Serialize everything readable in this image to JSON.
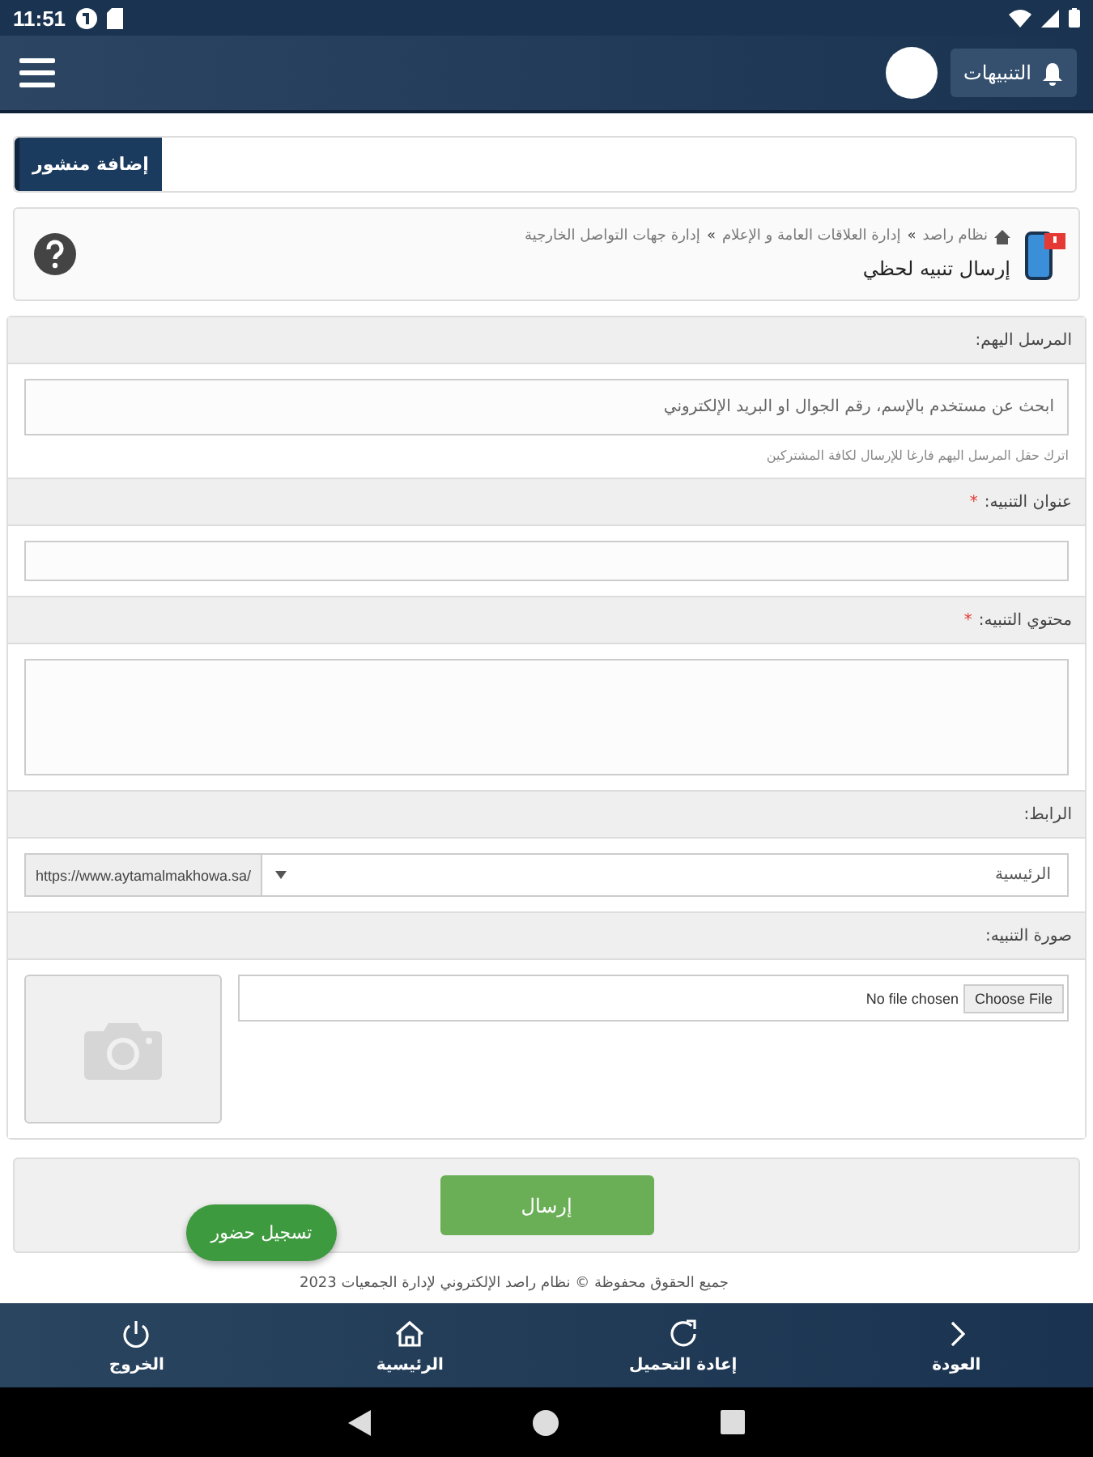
{
  "status_bar": {
    "time": "11:51"
  },
  "header": {
    "notifications_label": "التنبيهات"
  },
  "add_post_button": "إضافة منشور",
  "breadcrumb": {
    "items": [
      "نظام راصد",
      "إدارة العلاقات العامة و الإعلام",
      "إدارة جهات التواصل الخارجية"
    ],
    "separator": "»",
    "page_title": "إرسال تنبيه لحظي"
  },
  "form": {
    "recipients": {
      "label": "المرسل اليهم:",
      "placeholder": "ابحث عن مستخدم بالإسم، رقم الجوال او البريد الإلكتروني",
      "hint": "اترك حقل المرسل اليهم فارغا للإرسال لكافة المشتركين"
    },
    "title": {
      "label": "عنوان التنبيه:",
      "required_mark": "*"
    },
    "content": {
      "label": "محتوي التنبيه:",
      "required_mark": "*"
    },
    "link": {
      "label": "الرابط:",
      "select_value": "الرئيسية",
      "prefix": "https://www.aytamalmakhowa.sa/"
    },
    "image": {
      "label": "صورة التنبيه:",
      "file_button": "Choose File",
      "file_status": "No file chosen"
    }
  },
  "submit_button": "إرسال",
  "attendance_button": "تسجيل حضور",
  "footer": "جميع الحقوق محفوظة © نظام راصد الإلكتروني لإدارة الجمعيات 2023",
  "bottom_nav": [
    {
      "label": "العودة"
    },
    {
      "label": "إعادة التحميل"
    },
    {
      "label": "الرئيسية"
    },
    {
      "label": "الخروج"
    }
  ]
}
